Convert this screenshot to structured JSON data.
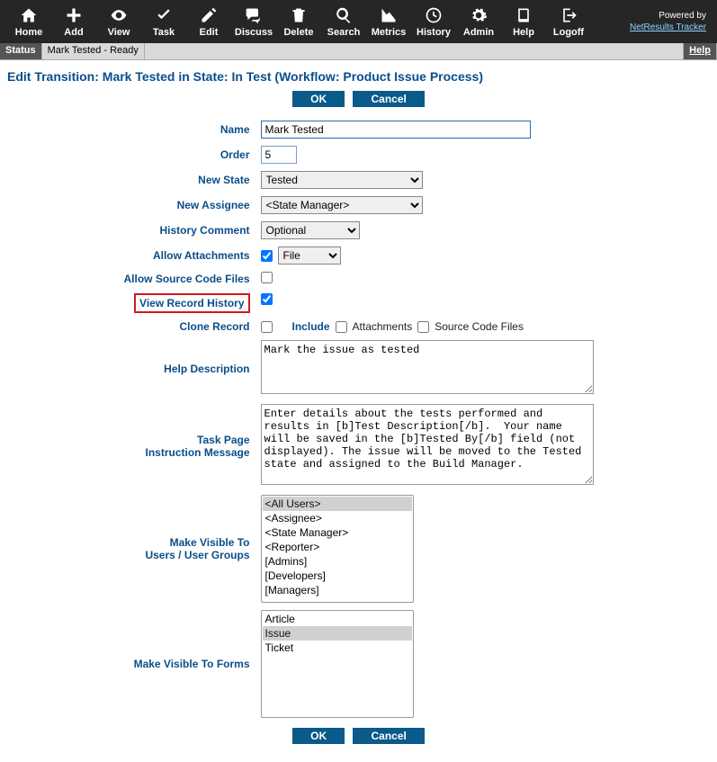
{
  "toolbar": {
    "items": [
      {
        "label": "Home",
        "icon": "home"
      },
      {
        "label": "Add",
        "icon": "plus"
      },
      {
        "label": "View",
        "icon": "eye"
      },
      {
        "label": "Task",
        "icon": "check"
      },
      {
        "label": "Edit",
        "icon": "pencil"
      },
      {
        "label": "Discuss",
        "icon": "comments"
      },
      {
        "label": "Delete",
        "icon": "trash"
      },
      {
        "label": "Search",
        "icon": "search"
      },
      {
        "label": "Metrics",
        "icon": "chart"
      },
      {
        "label": "History",
        "icon": "clock"
      },
      {
        "label": "Admin",
        "icon": "gear"
      },
      {
        "label": "Help",
        "icon": "book"
      },
      {
        "label": "Logoff",
        "icon": "logout"
      }
    ],
    "powered_by": "Powered by",
    "product_link": "NetResults Tracker"
  },
  "statusbar": {
    "status_label": "Status",
    "status_text": "Mark Tested - Ready",
    "help": "Help"
  },
  "page_title": "Edit Transition: Mark Tested in State: In Test (Workflow: Product Issue Process)",
  "buttons": {
    "ok": "OK",
    "cancel": "Cancel"
  },
  "form": {
    "name": {
      "label": "Name",
      "value": "Mark Tested"
    },
    "order": {
      "label": "Order",
      "value": "5"
    },
    "new_state": {
      "label": "New State",
      "value": "Tested"
    },
    "new_assignee": {
      "label": "New Assignee",
      "value": "<State Manager>"
    },
    "history_comment": {
      "label": "History Comment",
      "value": "Optional"
    },
    "allow_attachments": {
      "label": "Allow Attachments",
      "checked": true,
      "type": "File"
    },
    "allow_source": {
      "label": "Allow Source Code Files",
      "checked": false
    },
    "view_record_history": {
      "label": "View Record History",
      "checked": true
    },
    "clone_record": {
      "label": "Clone Record",
      "checked": false,
      "include": "Include",
      "attachments": "Attachments",
      "source": "Source Code Files"
    },
    "help_desc": {
      "label": "Help Description",
      "value": "Mark the issue as tested"
    },
    "task_instr": {
      "label_line1": "Task Page",
      "label_line2": "Instruction Message",
      "value": "Enter details about the tests performed and results in [b]Test Description[/b].  Your name will be saved in the [b]Tested By[/b] field (not displayed). The issue will be moved to the Tested state and assigned to the Build Manager."
    },
    "visible_users": {
      "label_line1": "Make Visible To",
      "label_line2": "Users / User Groups",
      "options": [
        "<All Users>",
        "<Assignee>",
        "<State Manager>",
        "<Reporter>",
        "[Admins]",
        "[Developers]",
        "[Managers]"
      ],
      "selected": [
        "<All Users>"
      ]
    },
    "visible_forms": {
      "label": "Make Visible To Forms",
      "options": [
        "Article",
        "Issue",
        "Ticket"
      ],
      "selected": [
        "Issue"
      ]
    }
  }
}
